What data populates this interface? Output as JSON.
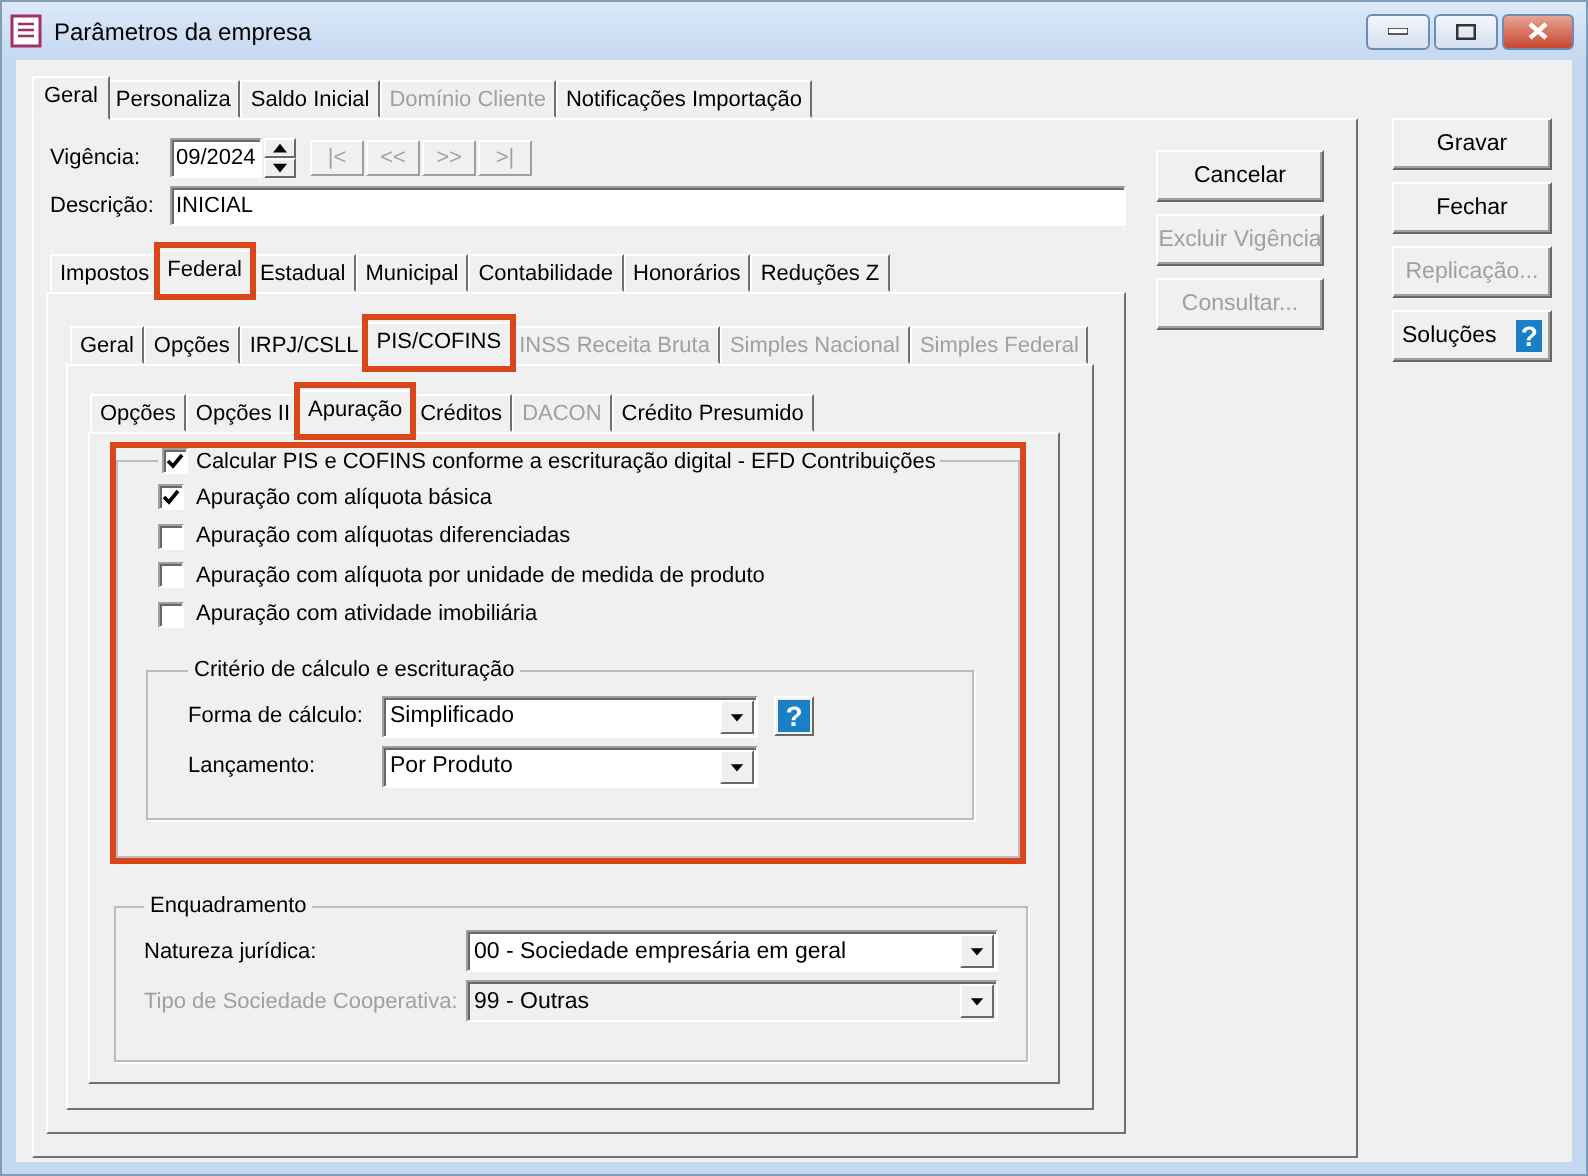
{
  "window": {
    "title": "Parâmetros da empresa"
  },
  "tabs": [
    {
      "label": "Geral",
      "selected": true,
      "disabled": false
    },
    {
      "label": "Personaliza",
      "selected": false,
      "disabled": false
    },
    {
      "label": "Saldo Inicial",
      "selected": false,
      "disabled": false
    },
    {
      "label": "Domínio Cliente",
      "selected": false,
      "disabled": true
    },
    {
      "label": "Notificações Importação",
      "selected": false,
      "disabled": false
    }
  ],
  "vigencia": {
    "label": "Vigência:",
    "value": "09/2024"
  },
  "nav_buttons": [
    {
      "label": "|<",
      "disabled": true
    },
    {
      "label": "<<",
      "disabled": true
    },
    {
      "label": ">>",
      "disabled": true
    },
    {
      "label": ">|",
      "disabled": true
    }
  ],
  "descricao": {
    "label": "Descrição:",
    "value": "INICIAL"
  },
  "side_buttons": [
    {
      "label": "Cancelar",
      "disabled": false
    },
    {
      "label": "Excluir Vigência",
      "disabled": true
    },
    {
      "label": "Consultar...",
      "disabled": true
    }
  ],
  "main_buttons": [
    {
      "label": "Gravar",
      "disabled": false,
      "kind": "plain"
    },
    {
      "label": "Fechar",
      "disabled": false,
      "kind": "plain"
    },
    {
      "label": "Replicação...",
      "disabled": true,
      "kind": "plain"
    },
    {
      "label": "Soluções",
      "disabled": false,
      "kind": "help",
      "help": "?"
    }
  ],
  "tax_tabs": [
    {
      "label": "Impostos",
      "selected": false,
      "disabled": false,
      "highlighted": false
    },
    {
      "label": "Federal",
      "selected": true,
      "disabled": false,
      "highlighted": true
    },
    {
      "label": "Estadual",
      "selected": false,
      "disabled": false,
      "highlighted": false
    },
    {
      "label": "Municipal",
      "selected": false,
      "disabled": false,
      "highlighted": false
    },
    {
      "label": "Contabilidade",
      "selected": false,
      "disabled": false,
      "highlighted": false
    },
    {
      "label": "Honorários",
      "selected": false,
      "disabled": false,
      "highlighted": false
    },
    {
      "label": "Reduções Z",
      "selected": false,
      "disabled": false,
      "highlighted": false
    }
  ],
  "federal_tabs": [
    {
      "label": "Geral",
      "selected": false,
      "disabled": false,
      "highlighted": false
    },
    {
      "label": "Opções",
      "selected": false,
      "disabled": false,
      "highlighted": false
    },
    {
      "label": "IRPJ/CSLL",
      "selected": false,
      "disabled": false,
      "highlighted": false
    },
    {
      "label": "PIS/COFINS",
      "selected": true,
      "disabled": false,
      "highlighted": true
    },
    {
      "label": "INSS Receita Bruta",
      "selected": false,
      "disabled": true,
      "highlighted": false
    },
    {
      "label": "Simples Nacional",
      "selected": false,
      "disabled": true,
      "highlighted": false
    },
    {
      "label": "Simples Federal",
      "selected": false,
      "disabled": true,
      "highlighted": false
    }
  ],
  "pis_cofins_tabs": [
    {
      "label": "Opções",
      "selected": false,
      "disabled": false,
      "highlighted": false
    },
    {
      "label": "Opções II",
      "selected": false,
      "disabled": false,
      "highlighted": false
    },
    {
      "label": "Apuração",
      "selected": true,
      "disabled": false,
      "highlighted": true
    },
    {
      "label": "Créditos",
      "selected": false,
      "disabled": false,
      "highlighted": false
    },
    {
      "label": "DACON",
      "selected": false,
      "disabled": true,
      "highlighted": false
    },
    {
      "label": "Crédito Presumido",
      "selected": false,
      "disabled": false,
      "highlighted": false
    }
  ],
  "efd_group": {
    "label": "Calcular PIS e COFINS conforme a escrituração digital - EFD Contribuições",
    "checked": true,
    "highlighted": true,
    "options": [
      {
        "label": "Apuração com alíquota básica",
        "checked": true
      },
      {
        "label": "Apuração com alíquotas diferenciadas",
        "checked": false
      },
      {
        "label": "Apuração com alíquota por unidade de medida de produto",
        "checked": false
      },
      {
        "label": "Apuração com atividade imobiliária",
        "checked": false
      }
    ],
    "criterio": {
      "title": "Critério de cálculo e escrituração",
      "fields": [
        {
          "label": "Forma de cálculo:",
          "value": "Simplificado",
          "help": "?"
        },
        {
          "label": "Lançamento:",
          "value": "Por Produto"
        }
      ]
    }
  },
  "enquadramento": {
    "title": "Enquadramento",
    "fields": [
      {
        "label": "Natureza jurídica:",
        "value": "00 - Sociedade empresária em geral",
        "disabled": false
      },
      {
        "label": "Tipo de Sociedade Cooperativa:",
        "value": "99 - Outras",
        "disabled": true
      }
    ]
  }
}
